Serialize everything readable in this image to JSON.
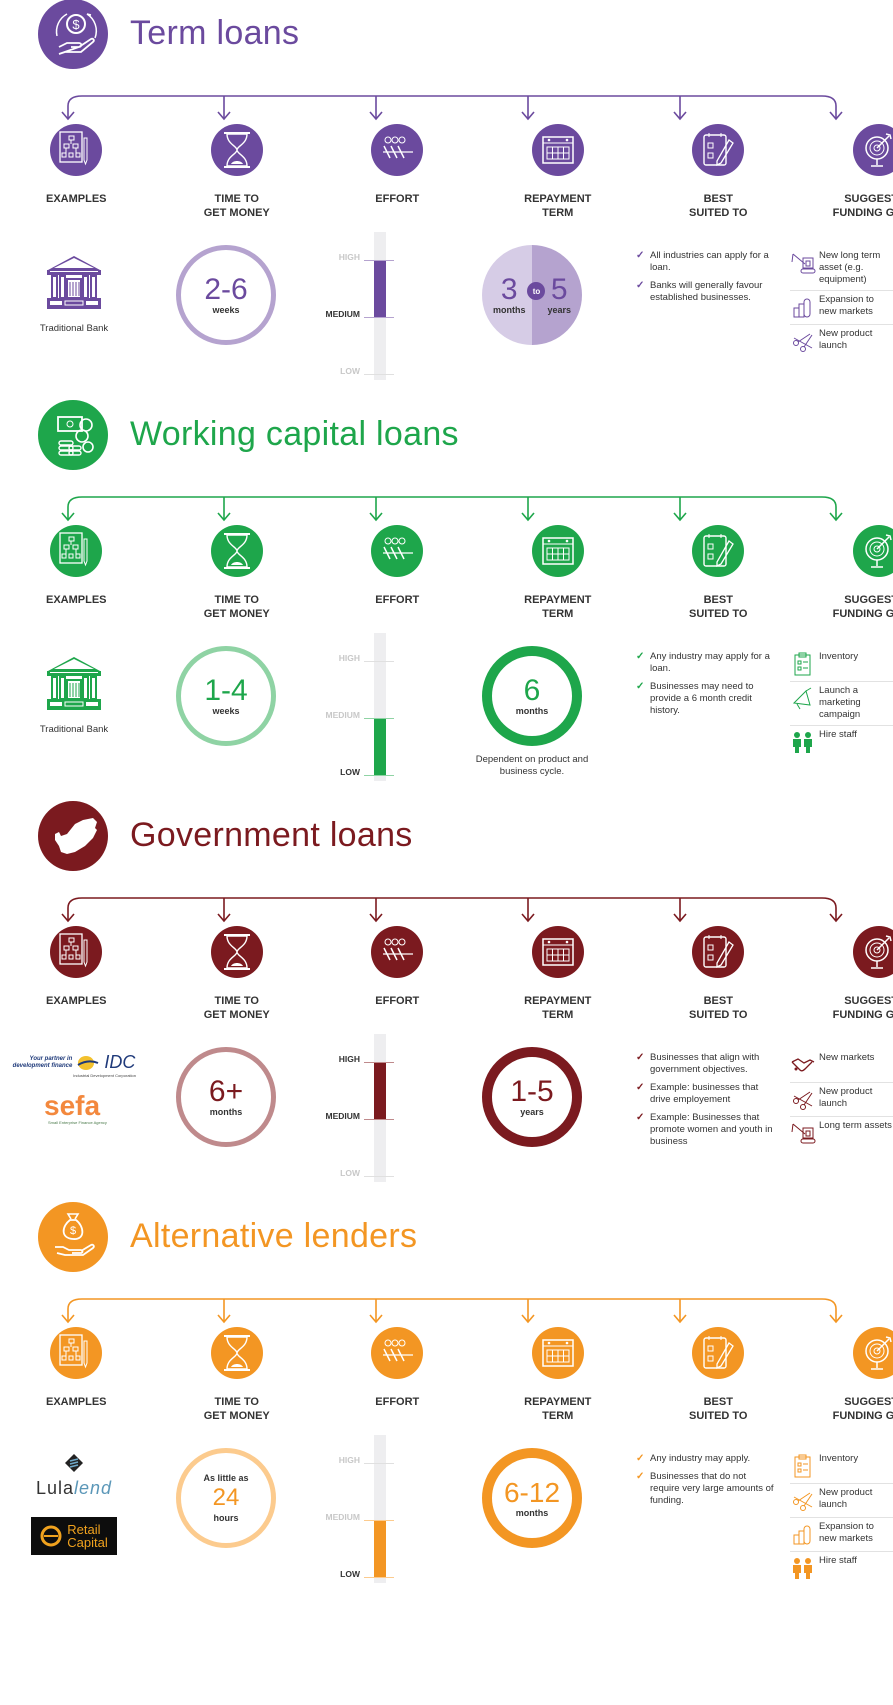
{
  "columns": [
    {
      "label_1": "EXAMPLES",
      "label_2": "",
      "icon": "org-chart-document-icon"
    },
    {
      "label_1": "TIME TO",
      "label_2": "GET MONEY",
      "icon": "hourglass-icon"
    },
    {
      "label_1": "EFFORT",
      "label_2": "",
      "icon": "tug-of-war-icon"
    },
    {
      "label_1": "REPAYMENT",
      "label_2": "TERM",
      "icon": "calendar-icon"
    },
    {
      "label_1": "BEST",
      "label_2": "SUITED TO",
      "icon": "checklist-pencil-icon"
    },
    {
      "label_1": "SUGGESTED",
      "label_2": "FUNDING GOALS",
      "icon": "target-arrow-icon"
    }
  ],
  "effort_scale": [
    "HIGH",
    "MEDIUM",
    "LOW"
  ],
  "sections": [
    {
      "id": "term",
      "title": "Term loans",
      "header_icon": "hand-dollar-cycle-icon",
      "colors": {
        "main": "#6b4a9e",
        "light": "#b5a3cf",
        "pale": "#d6cce6"
      },
      "examples": {
        "type": "bank",
        "caption": "Traditional Bank"
      },
      "time": {
        "pre": "",
        "big": "2-6",
        "unit": "weeks"
      },
      "effort": {
        "from": "MEDIUM",
        "to": "HIGH",
        "active_labels": [
          "MEDIUM"
        ]
      },
      "repayment": {
        "type": "split",
        "left_num": "3",
        "left_unit": "months",
        "connector": "to",
        "right_num": "5",
        "right_unit": "years",
        "note": ""
      },
      "suited": [
        "All industries can apply for a loan.",
        "Banks will generally favour established businesses."
      ],
      "goals": [
        {
          "icon": "crane-equipment-icon",
          "text": "New long term asset (e.g. equipment)"
        },
        {
          "icon": "bar-growth-icon",
          "text": "Expansion to new markets"
        },
        {
          "icon": "scissors-ribbon-icon",
          "text": "New product launch"
        }
      ]
    },
    {
      "id": "working",
      "title": "Working capital loans",
      "header_icon": "cash-coins-icon",
      "colors": {
        "main": "#1ea64b",
        "light": "#8fd3a4",
        "pale": "#c9ecd4"
      },
      "examples": {
        "type": "bank",
        "caption": "Traditional Bank"
      },
      "time": {
        "pre": "",
        "big": "1-4",
        "unit": "weeks"
      },
      "effort": {
        "from": "LOW",
        "to": "MEDIUM",
        "active_labels": [
          "LOW"
        ]
      },
      "repayment": {
        "type": "ring",
        "big": "6",
        "unit": "months",
        "note": "Dependent on product and business cycle."
      },
      "suited": [
        "Any industry may apply for a loan.",
        "Businesses may need to provide a 6 month credit history."
      ],
      "goals": [
        {
          "icon": "clipboard-inventory-icon",
          "text": "Inventory"
        },
        {
          "icon": "megaphone-icon",
          "text": "Launch a marketing campaign"
        },
        {
          "icon": "people-staff-icon",
          "text": "Hire staff"
        }
      ]
    },
    {
      "id": "government",
      "title": "Government loans",
      "header_icon": "south-africa-map-icon",
      "colors": {
        "main": "#7b1a1f",
        "light": "#bf8a8c",
        "pale": "#e5cfd0"
      },
      "examples": {
        "type": "gov",
        "idc_tagline_1": "Your partner in",
        "idc_tagline_2": "development finance",
        "idc_name": "IDC",
        "idc_sub": "Industrial Development Corporation",
        "sefa_name": "sefa",
        "sefa_sub": "Small Enterprise Finance Agency"
      },
      "time": {
        "pre": "",
        "big": "6+",
        "unit": "months"
      },
      "effort": {
        "from": "MEDIUM",
        "to": "HIGH",
        "active_labels": [
          "HIGH",
          "MEDIUM"
        ]
      },
      "repayment": {
        "type": "ring",
        "big": "1-5",
        "unit": "years",
        "note": ""
      },
      "suited": [
        "Businesses that align with government objectives.",
        "Example: businesses that drive employement",
        "Example: Businesses that promote women and youth in business"
      ],
      "goals": [
        {
          "icon": "handshake-icon",
          "text": "New markets"
        },
        {
          "icon": "scissors-ribbon-icon",
          "text": "New product launch"
        },
        {
          "icon": "crane-equipment-icon",
          "text": "Long term assets"
        }
      ]
    },
    {
      "id": "alternative",
      "title": "Alternative lenders",
      "header_icon": "money-bag-hand-icon",
      "colors": {
        "main": "#f39623",
        "light": "#fccb8e",
        "pale": "#fde3c2"
      },
      "examples": {
        "type": "alt",
        "lula_a": "Lula",
        "lula_b": "lend",
        "rc_1": "Retail",
        "rc_2": "Capital"
      },
      "time": {
        "pre": "As little as",
        "big": "24",
        "unit": "hours"
      },
      "effort": {
        "from": "LOW",
        "to": "MEDIUM",
        "active_labels": [
          "LOW"
        ]
      },
      "repayment": {
        "type": "ring",
        "big": "6-12",
        "unit": "months",
        "note": ""
      },
      "suited": [
        "Any industry may apply.",
        "Businesses that do not require very large amounts of funding."
      ],
      "goals": [
        {
          "icon": "clipboard-inventory-icon",
          "text": "Inventory"
        },
        {
          "icon": "scissors-ribbon-icon",
          "text": "New product launch"
        },
        {
          "icon": "bar-growth-icon",
          "text": "Expansion to new markets"
        },
        {
          "icon": "people-staff-icon",
          "text": "Hire staff"
        }
      ]
    }
  ]
}
